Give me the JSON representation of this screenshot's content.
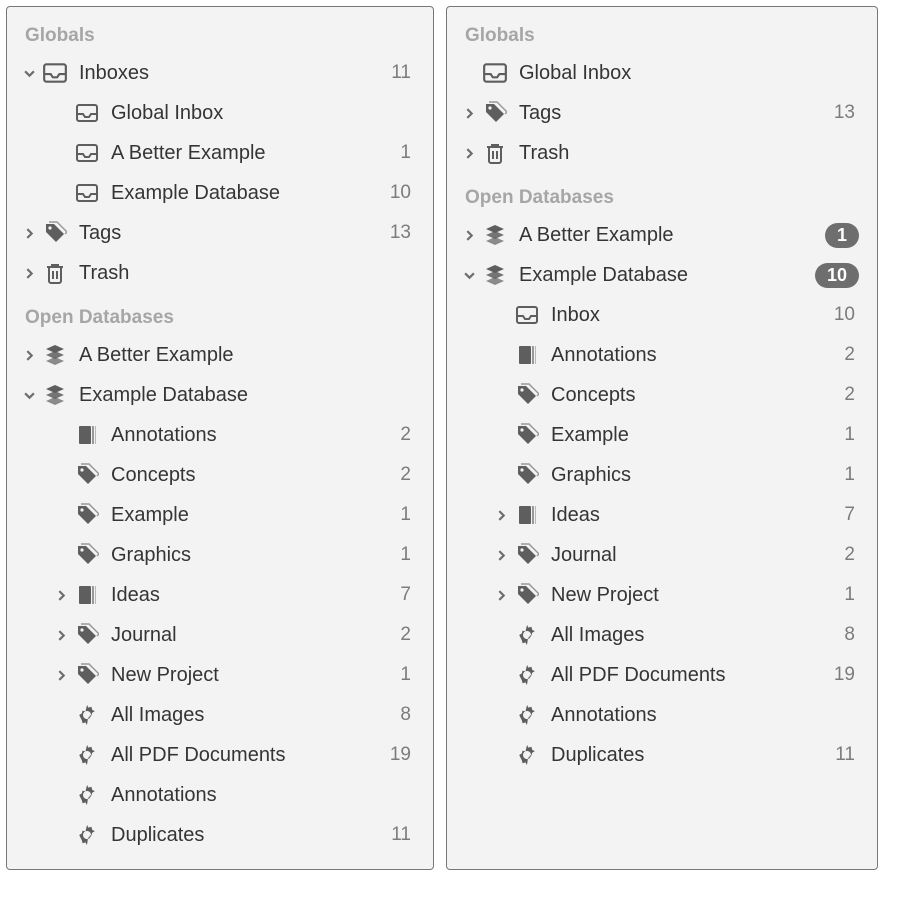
{
  "left": {
    "sections": {
      "globals": {
        "title": "Globals",
        "inboxes": {
          "label": "Inboxes",
          "count": "11"
        },
        "inboxChildren": [
          {
            "label": "Global Inbox",
            "count": ""
          },
          {
            "label": "A Better Example",
            "count": "1"
          },
          {
            "label": "Example Database",
            "count": "10"
          }
        ],
        "tags": {
          "label": "Tags",
          "count": "13"
        },
        "trash": {
          "label": "Trash",
          "count": ""
        }
      },
      "open": {
        "title": "Open Databases",
        "db1": {
          "label": "A Better Example"
        },
        "db2": {
          "label": "Example Database"
        },
        "db2Children": [
          {
            "icon": "book",
            "label": "Annotations",
            "count": "2",
            "disc": ""
          },
          {
            "icon": "tags",
            "label": "Concepts",
            "count": "2",
            "disc": ""
          },
          {
            "icon": "tags",
            "label": "Example",
            "count": "1",
            "disc": ""
          },
          {
            "icon": "tags",
            "label": "Graphics",
            "count": "1",
            "disc": ""
          },
          {
            "icon": "book",
            "label": "Ideas",
            "count": "7",
            "disc": "right"
          },
          {
            "icon": "tags",
            "label": "Journal",
            "count": "2",
            "disc": "right"
          },
          {
            "icon": "tags",
            "label": "New Project",
            "count": "1",
            "disc": "right"
          },
          {
            "icon": "gear",
            "label": "All Images",
            "count": "8",
            "disc": ""
          },
          {
            "icon": "gear",
            "label": "All PDF Documents",
            "count": "19",
            "disc": ""
          },
          {
            "icon": "gear",
            "label": "Annotations",
            "count": "",
            "disc": ""
          },
          {
            "icon": "gear",
            "label": "Duplicates",
            "count": "11",
            "disc": ""
          }
        ]
      }
    }
  },
  "right": {
    "sections": {
      "globals": {
        "title": "Globals",
        "globalInbox": {
          "label": "Global Inbox"
        },
        "tags": {
          "label": "Tags",
          "count": "13"
        },
        "trash": {
          "label": "Trash",
          "count": ""
        }
      },
      "open": {
        "title": "Open Databases",
        "db1": {
          "label": "A Better Example",
          "pill": "1"
        },
        "db2": {
          "label": "Example Database",
          "pill": "10"
        },
        "db2Children": [
          {
            "icon": "inbox",
            "label": "Inbox",
            "count": "10",
            "disc": ""
          },
          {
            "icon": "book",
            "label": "Annotations",
            "count": "2",
            "disc": ""
          },
          {
            "icon": "tags",
            "label": "Concepts",
            "count": "2",
            "disc": ""
          },
          {
            "icon": "tags",
            "label": "Example",
            "count": "1",
            "disc": ""
          },
          {
            "icon": "tags",
            "label": "Graphics",
            "count": "1",
            "disc": ""
          },
          {
            "icon": "book",
            "label": "Ideas",
            "count": "7",
            "disc": "right"
          },
          {
            "icon": "tags",
            "label": "Journal",
            "count": "2",
            "disc": "right"
          },
          {
            "icon": "tags",
            "label": "New Project",
            "count": "1",
            "disc": "right"
          },
          {
            "icon": "gear",
            "label": "All Images",
            "count": "8",
            "disc": ""
          },
          {
            "icon": "gear",
            "label": "All PDF Documents",
            "count": "19",
            "disc": ""
          },
          {
            "icon": "gear",
            "label": "Annotations",
            "count": "",
            "disc": ""
          },
          {
            "icon": "gear",
            "label": "Duplicates",
            "count": "11",
            "disc": ""
          }
        ]
      }
    }
  }
}
